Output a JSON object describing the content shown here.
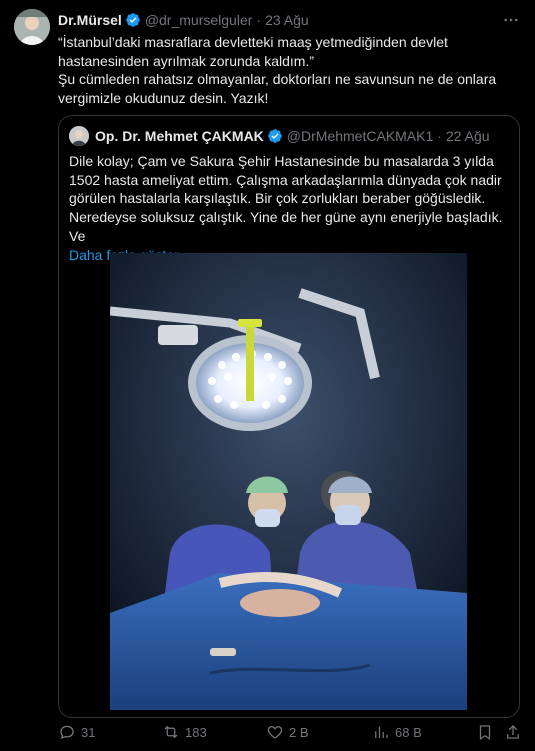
{
  "tweet": {
    "author_name": "Dr.Mürsel",
    "handle": "@dr_murselguler",
    "separator": "·",
    "date": "23 Ağu",
    "text_line1": "“İstanbul’daki masraflara devletteki maaş yetmediğinden devlet hastanesinden ayrılmak zorunda kaldım.”",
    "text_line2": "Şu cümleden rahatsız olmayanlar, doktorları ne savunsun ne de onlara vergimizle okudunuz desin. Yazık!",
    "more_icon": "ellipsis-icon"
  },
  "quoted": {
    "author_name": "Op. Dr. Mehmet ÇAKMAK",
    "handle": "@DrMehmetCAKMAK1",
    "separator": "·",
    "date": "22 Ağu",
    "text": "Dile kolay; Çam ve Sakura Şehir Hastanesinde bu masalarda 3 yılda 1502 hasta ameliyat ettim. Çalışma arkadaşlarımla dünyada çok nadir görülen hastalarla karşılaştık. Bir çok zorlukları beraber göğüsledik. Neredeyse soluksuz çalıştık. Yine de her güne aynı enerjiyle başladık. Ve",
    "show_more": "Daha fazla göster"
  },
  "actions": {
    "replies": "31",
    "retweets": "183",
    "likes": "2 B",
    "views": "68 B"
  },
  "colors": {
    "background": "#000000",
    "text": "#e7e9ea",
    "muted": "#71767b",
    "link": "#1d9bf0",
    "verified": "#1d9bf0",
    "border": "#2f3336"
  }
}
